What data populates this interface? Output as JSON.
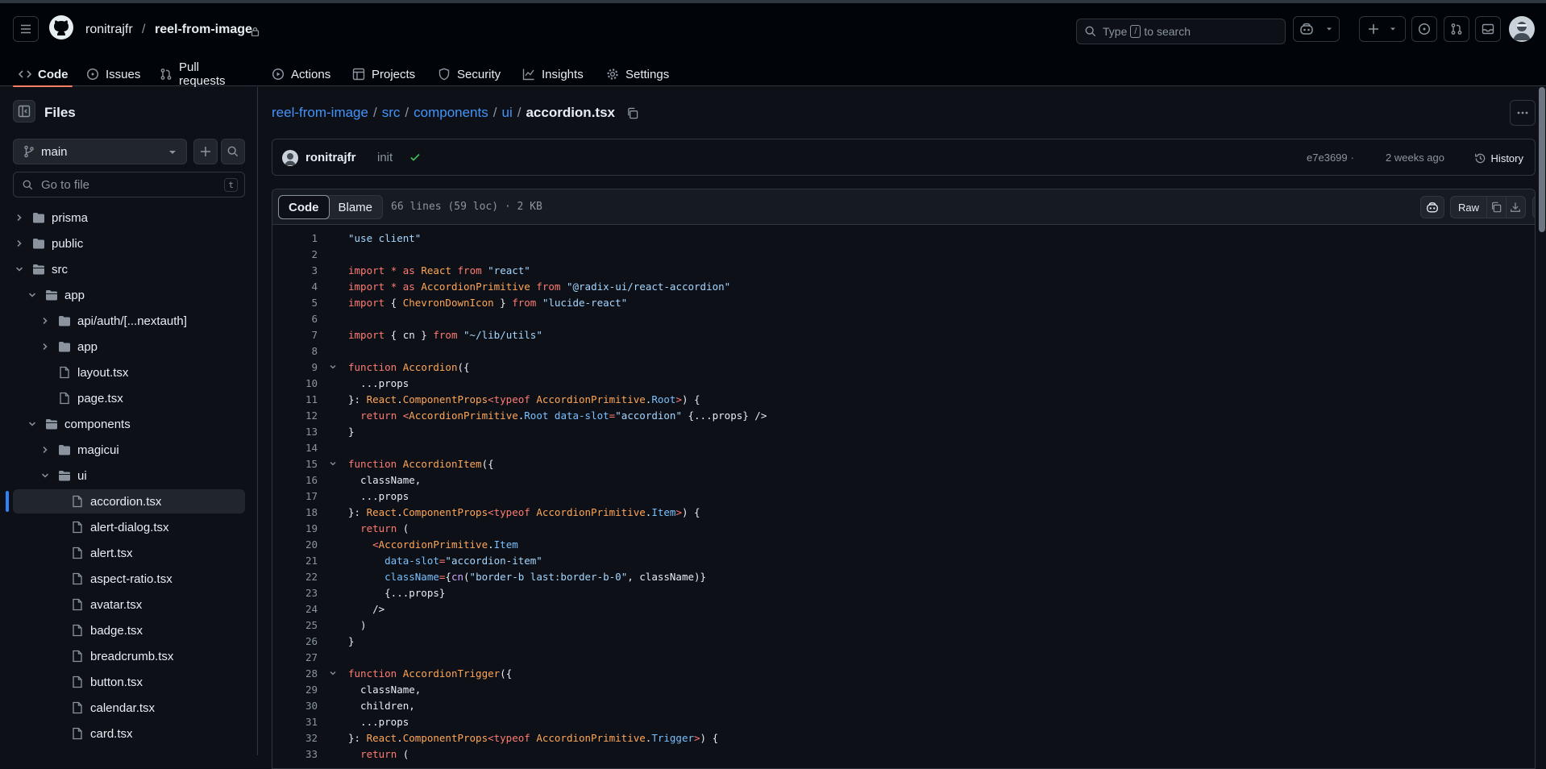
{
  "header": {
    "owner": "ronitrajfr",
    "separator": "/",
    "repo": "reel-from-image",
    "search_prefix": "Type",
    "search_key": "/",
    "search_suffix": "to search"
  },
  "reponav": {
    "items": [
      {
        "label": "Code",
        "icon": "code-icon"
      },
      {
        "label": "Issues",
        "icon": "issue-opened-icon"
      },
      {
        "label": "Pull requests",
        "icon": "git-pull-request-icon"
      },
      {
        "label": "Actions",
        "icon": "play-icon"
      },
      {
        "label": "Projects",
        "icon": "table-icon"
      },
      {
        "label": "Security",
        "icon": "shield-icon"
      },
      {
        "label": "Insights",
        "icon": "graph-icon"
      },
      {
        "label": "Settings",
        "icon": "gear-icon"
      }
    ]
  },
  "sidebar": {
    "title": "Files",
    "branch": "main",
    "goto_placeholder": "Go to file",
    "goto_key": "t",
    "tree": [
      {
        "label": "prisma",
        "type": "folder",
        "expanded": false,
        "depth": 0
      },
      {
        "label": "public",
        "type": "folder",
        "expanded": false,
        "depth": 0
      },
      {
        "label": "src",
        "type": "folder",
        "expanded": true,
        "depth": 0
      },
      {
        "label": "app",
        "type": "folder",
        "expanded": true,
        "depth": 1
      },
      {
        "label": "api/auth/[...nextauth]",
        "type": "folder",
        "expanded": false,
        "depth": 2
      },
      {
        "label": "app",
        "type": "folder",
        "expanded": false,
        "depth": 2
      },
      {
        "label": "layout.tsx",
        "type": "file",
        "depth": 2
      },
      {
        "label": "page.tsx",
        "type": "file",
        "depth": 2
      },
      {
        "label": "components",
        "type": "folder",
        "expanded": true,
        "depth": 1
      },
      {
        "label": "magicui",
        "type": "folder",
        "expanded": false,
        "depth": 2
      },
      {
        "label": "ui",
        "type": "folder",
        "expanded": true,
        "depth": 2
      },
      {
        "label": "accordion.tsx",
        "type": "file",
        "depth": 3,
        "selected": true
      },
      {
        "label": "alert-dialog.tsx",
        "type": "file",
        "depth": 3
      },
      {
        "label": "alert.tsx",
        "type": "file",
        "depth": 3
      },
      {
        "label": "aspect-ratio.tsx",
        "type": "file",
        "depth": 3
      },
      {
        "label": "avatar.tsx",
        "type": "file",
        "depth": 3
      },
      {
        "label": "badge.tsx",
        "type": "file",
        "depth": 3
      },
      {
        "label": "breadcrumb.tsx",
        "type": "file",
        "depth": 3
      },
      {
        "label": "button.tsx",
        "type": "file",
        "depth": 3
      },
      {
        "label": "calendar.tsx",
        "type": "file",
        "depth": 3
      },
      {
        "label": "card.tsx",
        "type": "file",
        "depth": 3
      }
    ]
  },
  "breadcrumb": {
    "parts": [
      "reel-from-image",
      "src",
      "components",
      "ui"
    ],
    "separator": "/",
    "current": "accordion.tsx"
  },
  "commit": {
    "author": "ronitrajfr",
    "message": "init",
    "sha": "e7e3699",
    "dot": "·",
    "time": "2 weeks ago",
    "history_label": "History"
  },
  "viewer": {
    "tab_code": "Code",
    "tab_blame": "Blame",
    "meta": "66 lines (59 loc) · 2 KB",
    "raw_label": "Raw"
  },
  "code_lines": [
    {
      "n": "1",
      "fold": false,
      "tokens": [
        [
          "s",
          "\"use client\""
        ]
      ]
    },
    {
      "n": "2",
      "fold": false,
      "tokens": []
    },
    {
      "n": "3",
      "fold": false,
      "tokens": [
        [
          "k",
          "import"
        ],
        [
          "",
          " "
        ],
        [
          "k",
          "*"
        ],
        [
          "",
          " "
        ],
        [
          "k",
          "as"
        ],
        [
          "",
          " "
        ],
        [
          "c",
          "React"
        ],
        [
          "",
          " "
        ],
        [
          "k",
          "from"
        ],
        [
          "",
          " "
        ],
        [
          "s",
          "\"react\""
        ]
      ]
    },
    {
      "n": "4",
      "fold": false,
      "tokens": [
        [
          "k",
          "import"
        ],
        [
          "",
          " "
        ],
        [
          "k",
          "*"
        ],
        [
          "",
          " "
        ],
        [
          "k",
          "as"
        ],
        [
          "",
          " "
        ],
        [
          "c",
          "AccordionPrimitive"
        ],
        [
          "",
          " "
        ],
        [
          "k",
          "from"
        ],
        [
          "",
          " "
        ],
        [
          "s",
          "\"@radix-ui/react-accordion\""
        ]
      ]
    },
    {
      "n": "5",
      "fold": false,
      "tokens": [
        [
          "k",
          "import"
        ],
        [
          "",
          " { "
        ],
        [
          "c",
          "ChevronDownIcon"
        ],
        [
          "",
          " } "
        ],
        [
          "k",
          "from"
        ],
        [
          "",
          " "
        ],
        [
          "s",
          "\"lucide-react\""
        ]
      ]
    },
    {
      "n": "6",
      "fold": false,
      "tokens": []
    },
    {
      "n": "7",
      "fold": false,
      "tokens": [
        [
          "k",
          "import"
        ],
        [
          "",
          " { cn } "
        ],
        [
          "k",
          "from"
        ],
        [
          "",
          " "
        ],
        [
          "s",
          "\"~/lib/utils\""
        ]
      ]
    },
    {
      "n": "8",
      "fold": false,
      "tokens": []
    },
    {
      "n": "9",
      "fold": true,
      "tokens": [
        [
          "k",
          "function"
        ],
        [
          "",
          " "
        ],
        [
          "c",
          "Accordion"
        ],
        [
          "",
          "({"
        ]
      ]
    },
    {
      "n": "10",
      "fold": false,
      "tokens": [
        [
          "",
          "  ...props"
        ]
      ]
    },
    {
      "n": "11",
      "fold": false,
      "tokens": [
        [
          "",
          "}: "
        ],
        [
          "c",
          "React"
        ],
        [
          "",
          "."
        ],
        [
          "c",
          "ComponentProps"
        ],
        [
          "k",
          "<typeof"
        ],
        [
          "",
          " "
        ],
        [
          "c",
          "AccordionPrimitive"
        ],
        [
          "",
          "."
        ],
        [
          "v",
          "Root"
        ],
        [
          "k",
          ">"
        ],
        [
          "",
          ") {"
        ]
      ]
    },
    {
      "n": "12",
      "fold": false,
      "tokens": [
        [
          "",
          "  "
        ],
        [
          "k",
          "return"
        ],
        [
          "",
          " "
        ],
        [
          "k",
          "<"
        ],
        [
          "c",
          "AccordionPrimitive"
        ],
        [
          "",
          "."
        ],
        [
          "v",
          "Root"
        ],
        [
          "",
          " "
        ],
        [
          "v",
          "data-slot"
        ],
        [
          "k",
          "="
        ],
        [
          "s",
          "\"accordion\""
        ],
        [
          "",
          " {...props} />"
        ]
      ]
    },
    {
      "n": "13",
      "fold": false,
      "tokens": [
        [
          "",
          "}"
        ]
      ]
    },
    {
      "n": "14",
      "fold": false,
      "tokens": []
    },
    {
      "n": "15",
      "fold": true,
      "tokens": [
        [
          "k",
          "function"
        ],
        [
          "",
          " "
        ],
        [
          "c",
          "AccordionItem"
        ],
        [
          "",
          "({"
        ]
      ]
    },
    {
      "n": "16",
      "fold": false,
      "tokens": [
        [
          "",
          "  className,"
        ]
      ]
    },
    {
      "n": "17",
      "fold": false,
      "tokens": [
        [
          "",
          "  ...props"
        ]
      ]
    },
    {
      "n": "18",
      "fold": false,
      "tokens": [
        [
          "",
          "}: "
        ],
        [
          "c",
          "React"
        ],
        [
          "",
          "."
        ],
        [
          "c",
          "ComponentProps"
        ],
        [
          "k",
          "<typeof"
        ],
        [
          "",
          " "
        ],
        [
          "c",
          "AccordionPrimitive"
        ],
        [
          "",
          "."
        ],
        [
          "v",
          "Item"
        ],
        [
          "k",
          ">"
        ],
        [
          "",
          ") {"
        ]
      ]
    },
    {
      "n": "19",
      "fold": false,
      "tokens": [
        [
          "",
          "  "
        ],
        [
          "k",
          "return"
        ],
        [
          "",
          " ("
        ]
      ]
    },
    {
      "n": "20",
      "fold": false,
      "tokens": [
        [
          "",
          "    "
        ],
        [
          "k",
          "<"
        ],
        [
          "c",
          "AccordionPrimitive"
        ],
        [
          "",
          "."
        ],
        [
          "v",
          "Item"
        ]
      ]
    },
    {
      "n": "21",
      "fold": false,
      "tokens": [
        [
          "",
          "      "
        ],
        [
          "v",
          "data-slot"
        ],
        [
          "k",
          "="
        ],
        [
          "s",
          "\"accordion-item\""
        ]
      ]
    },
    {
      "n": "22",
      "fold": false,
      "tokens": [
        [
          "",
          "      "
        ],
        [
          "v",
          "className"
        ],
        [
          "k",
          "="
        ],
        [
          "",
          "{"
        ],
        [
          "f",
          "cn"
        ],
        [
          "",
          "("
        ],
        [
          "s",
          "\"border-b last:border-b-0\""
        ],
        [
          "",
          ", className)}"
        ]
      ]
    },
    {
      "n": "23",
      "fold": false,
      "tokens": [
        [
          "",
          "      {...props}"
        ]
      ]
    },
    {
      "n": "24",
      "fold": false,
      "tokens": [
        [
          "",
          "    />"
        ]
      ]
    },
    {
      "n": "25",
      "fold": false,
      "tokens": [
        [
          "",
          "  )"
        ]
      ]
    },
    {
      "n": "26",
      "fold": false,
      "tokens": [
        [
          "",
          "}"
        ]
      ]
    },
    {
      "n": "27",
      "fold": false,
      "tokens": []
    },
    {
      "n": "28",
      "fold": true,
      "tokens": [
        [
          "k",
          "function"
        ],
        [
          "",
          " "
        ],
        [
          "c",
          "AccordionTrigger"
        ],
        [
          "",
          "({"
        ]
      ]
    },
    {
      "n": "29",
      "fold": false,
      "tokens": [
        [
          "",
          "  className,"
        ]
      ]
    },
    {
      "n": "30",
      "fold": false,
      "tokens": [
        [
          "",
          "  children,"
        ]
      ]
    },
    {
      "n": "31",
      "fold": false,
      "tokens": [
        [
          "",
          "  ...props"
        ]
      ]
    },
    {
      "n": "32",
      "fold": false,
      "tokens": [
        [
          "",
          "}: "
        ],
        [
          "c",
          "React"
        ],
        [
          "",
          "."
        ],
        [
          "c",
          "ComponentProps"
        ],
        [
          "k",
          "<typeof"
        ],
        [
          "",
          " "
        ],
        [
          "c",
          "AccordionPrimitive"
        ],
        [
          "",
          "."
        ],
        [
          "v",
          "Trigger"
        ],
        [
          "k",
          ">"
        ],
        [
          "",
          ") {"
        ]
      ]
    },
    {
      "n": "33",
      "fold": false,
      "tokens": [
        [
          "",
          "  "
        ],
        [
          "k",
          "return"
        ],
        [
          "",
          " ("
        ]
      ]
    }
  ],
  "colors": {
    "bg": "#0d1117",
    "header_bg": "#010409",
    "border": "#30363d",
    "link": "#4493f8",
    "accent_underline": "#f78166",
    "success": "#3fb950"
  }
}
